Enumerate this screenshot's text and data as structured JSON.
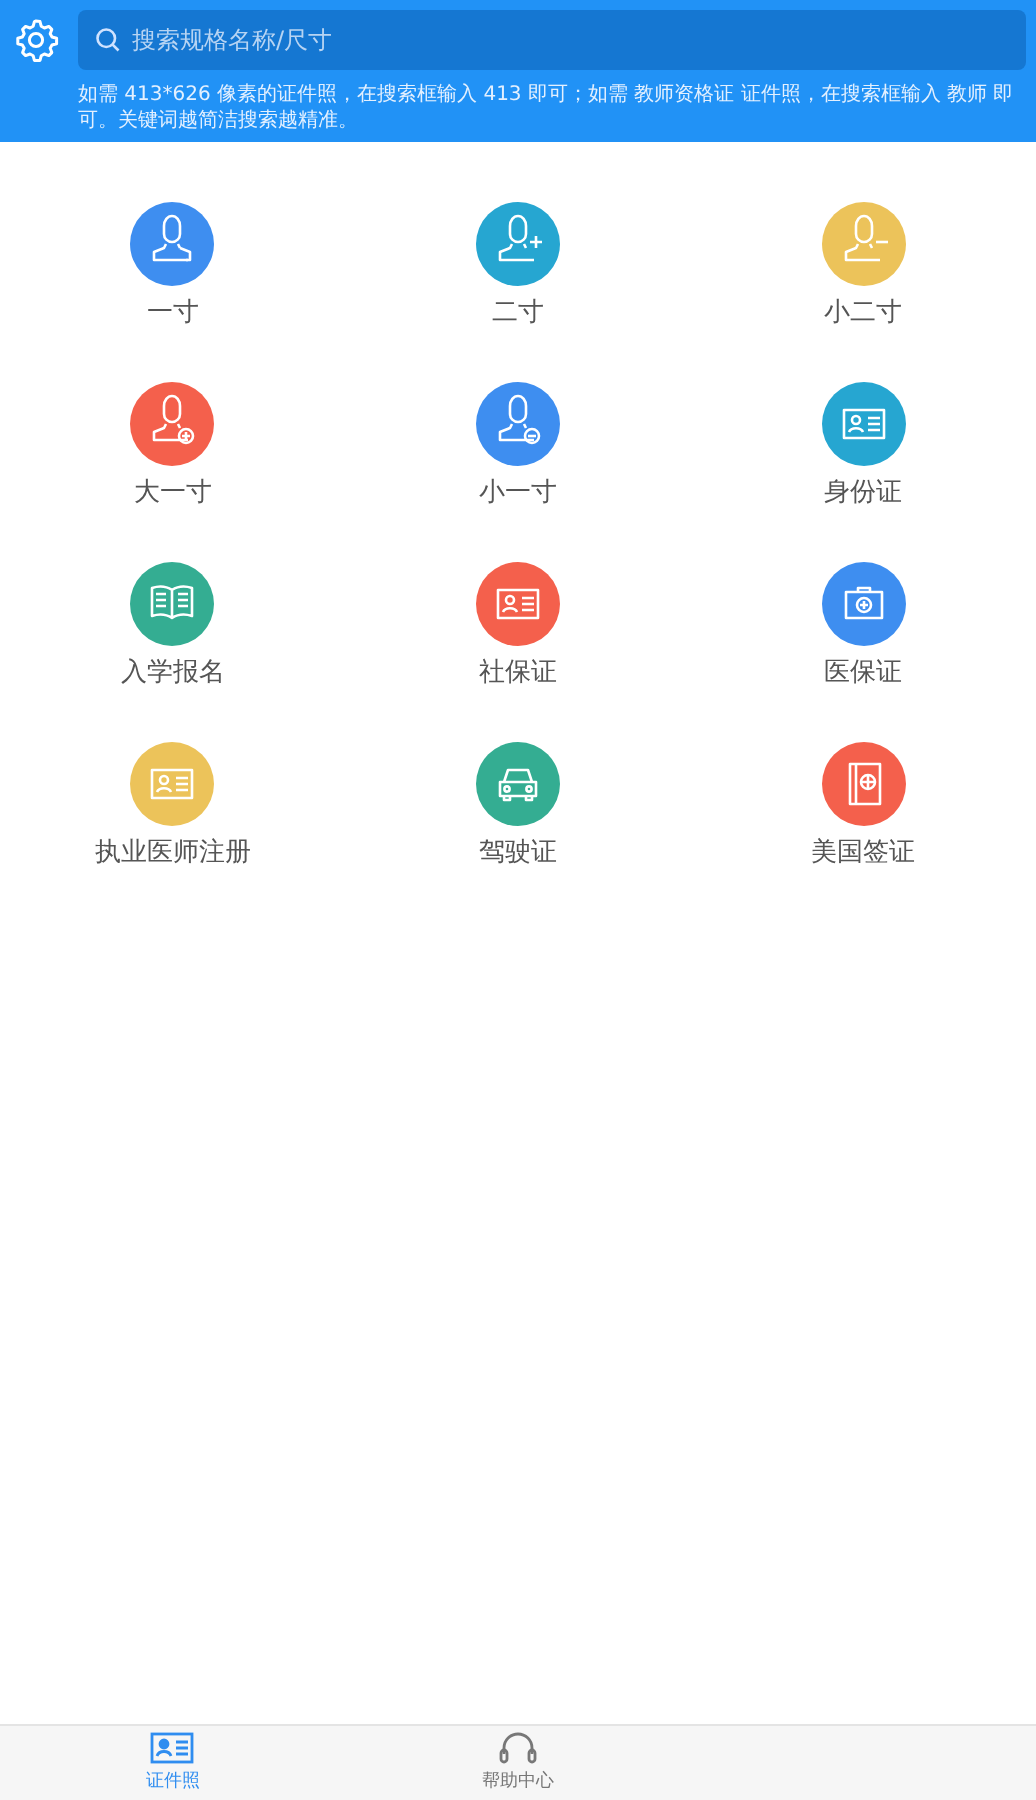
{
  "header": {
    "search": {
      "placeholder": "搜索规格名称/尺寸"
    },
    "hint": "如需 413*626 像素的证件照，在搜索框输入 413 即可；如需 教师资格证 证件照，在搜索框输入 教师 即可。关键词越简洁搜索越精准。"
  },
  "items": [
    {
      "label": "一寸",
      "kind": "person",
      "color": "#3e8ef0"
    },
    {
      "label": "二寸",
      "kind": "person-plus",
      "color": "#26a6d1"
    },
    {
      "label": "小二寸",
      "kind": "person-minus",
      "color": "#ecc35a"
    },
    {
      "label": "大一寸",
      "kind": "person-plus-circle",
      "color": "#f4604c"
    },
    {
      "label": "小一寸",
      "kind": "person-minus-circle",
      "color": "#3e8ef0"
    },
    {
      "label": "身份证",
      "kind": "id-card",
      "color": "#26a6d1"
    },
    {
      "label": "入学报名",
      "kind": "book",
      "color": "#34ad92"
    },
    {
      "label": "社保证",
      "kind": "id-card",
      "color": "#f4604c"
    },
    {
      "label": "医保证",
      "kind": "medical-kit",
      "color": "#3e8ef0"
    },
    {
      "label": "执业医师注册",
      "kind": "id-card",
      "color": "#ecc35a"
    },
    {
      "label": "驾驶证",
      "kind": "car",
      "color": "#34ad92"
    },
    {
      "label": "美国签证",
      "kind": "passport",
      "color": "#f4604c"
    }
  ],
  "tabs": [
    {
      "label": "证件照",
      "kind": "id-card",
      "selected": true
    },
    {
      "label": "帮助中心",
      "kind": "headset",
      "selected": false
    }
  ]
}
